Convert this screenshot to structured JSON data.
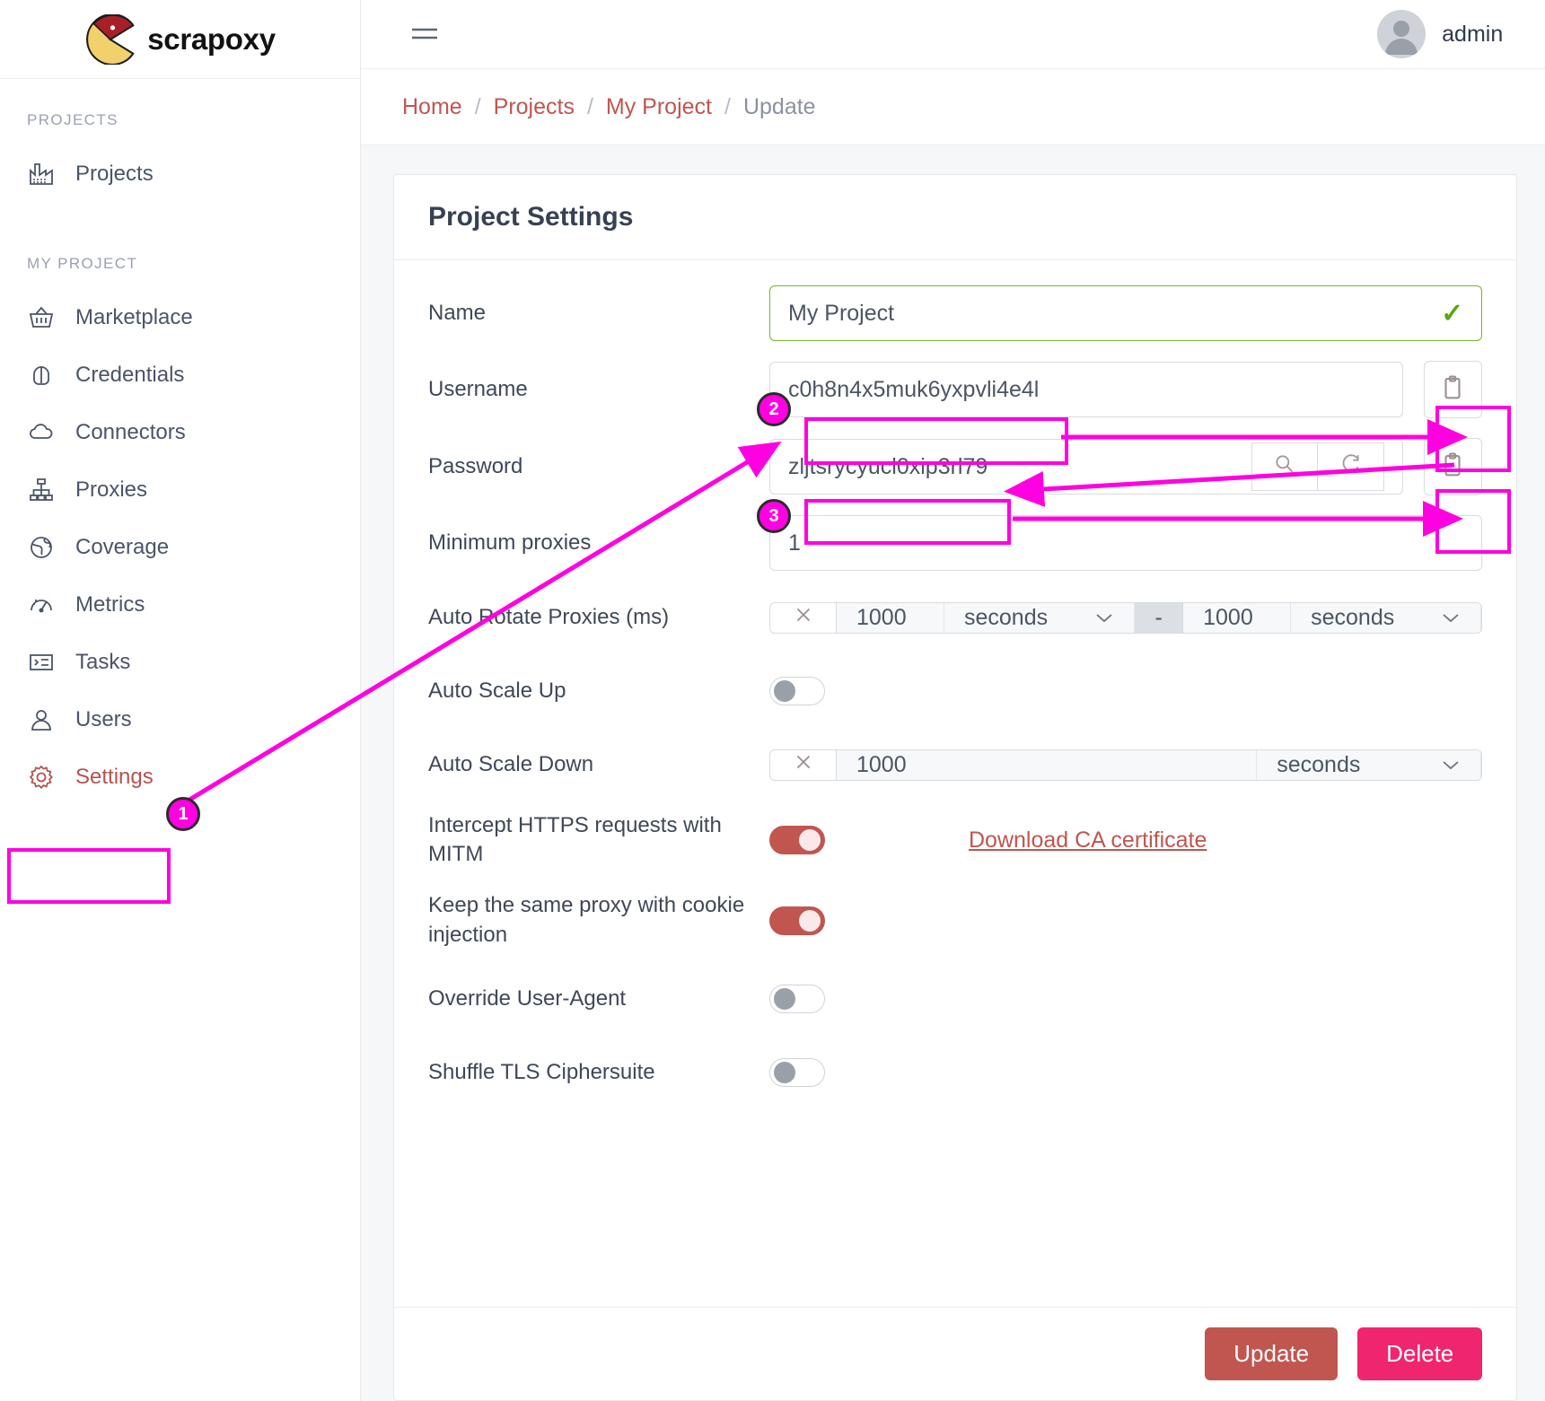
{
  "brand": {
    "name": "scrapoxy",
    "logo_icon": "pacman-logo-icon"
  },
  "topbar": {
    "menu_icon": "hamburger-menu-icon",
    "avatar_icon": "user-avatar-icon",
    "user_name": "admin"
  },
  "breadcrumb": {
    "items": [
      {
        "label": "Home",
        "current": false
      },
      {
        "label": "Projects",
        "current": false
      },
      {
        "label": "My Project",
        "current": false
      },
      {
        "label": "Update",
        "current": true
      }
    ],
    "separator": "/"
  },
  "sidebar": {
    "group1_title": "PROJECTS",
    "group1_items": [
      {
        "label": "Projects",
        "icon": "factory-icon",
        "active": false
      }
    ],
    "group2_title": "MY PROJECT",
    "group2_items": [
      {
        "label": "Marketplace",
        "icon": "basket-icon",
        "active": false
      },
      {
        "label": "Credentials",
        "icon": "lock-icon",
        "active": false
      },
      {
        "label": "Connectors",
        "icon": "cloud-icon",
        "active": false
      },
      {
        "label": "Proxies",
        "icon": "sitemap-icon",
        "active": false
      },
      {
        "label": "Coverage",
        "icon": "globe-icon",
        "active": false
      },
      {
        "label": "Metrics",
        "icon": "speedometer-icon",
        "active": false
      },
      {
        "label": "Tasks",
        "icon": "list-icon",
        "active": false
      },
      {
        "label": "Users",
        "icon": "user-icon",
        "active": false
      },
      {
        "label": "Settings",
        "icon": "gear-icon",
        "active": true
      }
    ]
  },
  "card": {
    "title": "Project Settings",
    "fields": {
      "name": {
        "label": "Name",
        "value": "My Project",
        "valid_icon": "checkmark-icon"
      },
      "username": {
        "label": "Username",
        "value": "c0h8n4x5muk6yxpvli4e4l",
        "copy_icon": "clipboard-icon"
      },
      "password": {
        "label": "Password",
        "value": "zljtsrycyucl0xip3rl79",
        "show_icon": "magnifier-icon",
        "refresh_icon": "refresh-icon",
        "copy_icon": "clipboard-icon"
      },
      "minimum_proxies": {
        "label": "Minimum proxies",
        "value": "1"
      },
      "auto_rotate": {
        "label": "Auto Rotate Proxies (ms)",
        "clear_icon": "close-x-icon",
        "min_value": "1000",
        "min_unit": "seconds",
        "separator": "-",
        "max_value": "1000",
        "max_unit": "seconds",
        "chevron_icon": "chevron-down-icon"
      },
      "auto_scale_up": {
        "label": "Auto Scale Up",
        "enabled": false
      },
      "auto_scale_down": {
        "label": "Auto Scale Down",
        "clear_icon": "close-x-icon",
        "value": "1000",
        "unit": "seconds",
        "chevron_icon": "chevron-down-icon"
      },
      "mitm": {
        "label": "Intercept HTTPS requests with MITM",
        "enabled": true,
        "link_label": "Download CA certificate"
      },
      "cookie_injection": {
        "label": "Keep the same proxy with cookie injection",
        "enabled": true
      },
      "override_ua": {
        "label": "Override User-Agent",
        "enabled": false
      },
      "shuffle_tls": {
        "label": "Shuffle TLS Ciphersuite",
        "enabled": false
      }
    },
    "footer": {
      "update_label": "Update",
      "delete_label": "Delete"
    }
  },
  "annotations": {
    "accent_color": "#ff00e0",
    "badges": [
      {
        "number": "1",
        "target": "settings-nav-item"
      },
      {
        "number": "2",
        "target": "username-field"
      },
      {
        "number": "3",
        "target": "password-field"
      }
    ]
  },
  "colors": {
    "accent_pink": "#ff00e0",
    "brand_red": "#c0564f",
    "delete_pink": "#f0256f",
    "valid_green": "#7bb32e"
  }
}
